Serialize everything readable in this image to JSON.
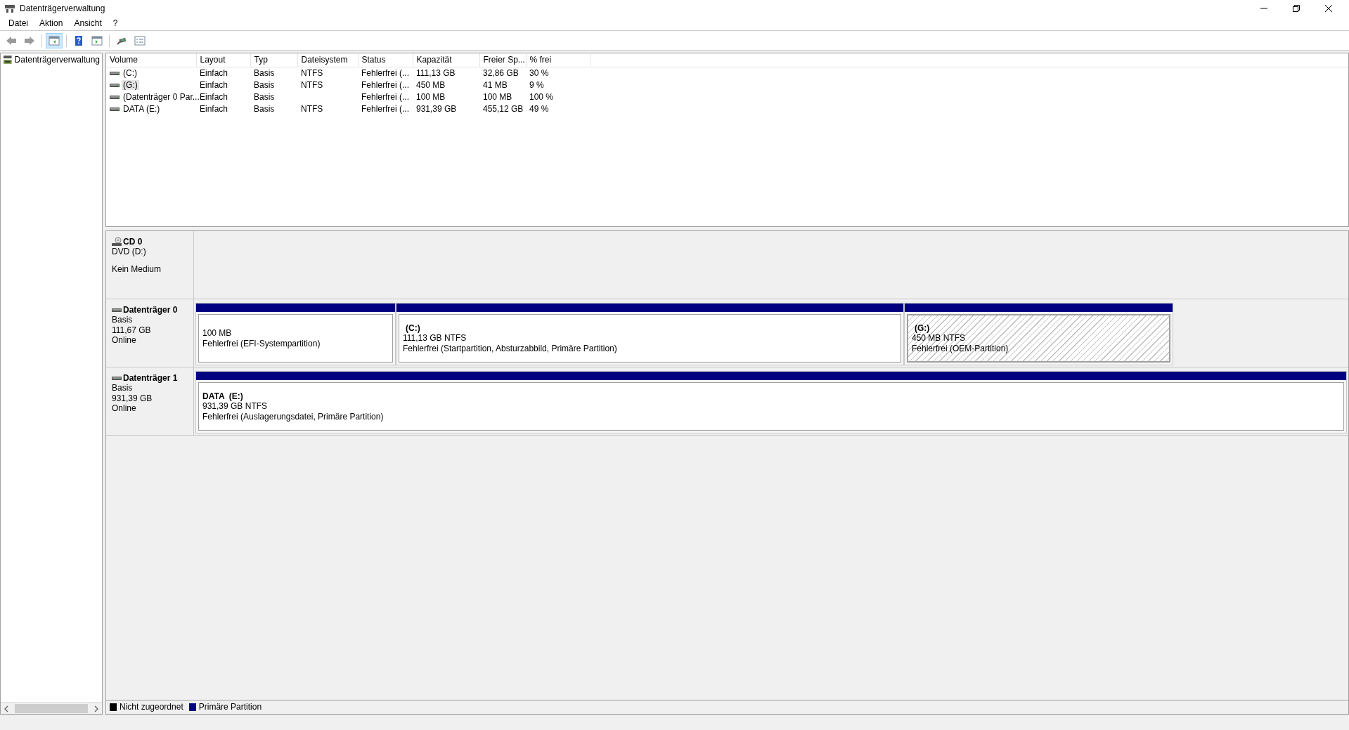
{
  "window": {
    "title": "Datenträgerverwaltung"
  },
  "menu": [
    "Datei",
    "Aktion",
    "Ansicht",
    "?"
  ],
  "toolbar": [
    {
      "kind": "back",
      "pressed": false
    },
    {
      "kind": "forward",
      "pressed": false
    },
    {
      "kind": "tree",
      "pressed": true
    },
    {
      "kind": "help",
      "pressed": false
    },
    {
      "kind": "pane",
      "pressed": false
    },
    {
      "kind": "connect",
      "pressed": false
    },
    {
      "kind": "list",
      "pressed": false
    }
  ],
  "tree": {
    "items": [
      {
        "label": "Datenträgerverwaltung",
        "selected": false
      }
    ]
  },
  "volume_table": {
    "columns": [
      "Volume",
      "Layout",
      "Typ",
      "Dateisystem",
      "Status",
      "Kapazität",
      "Freier Sp...",
      "% frei"
    ],
    "rows": [
      {
        "selected": false,
        "cells": [
          "(C:)",
          "Einfach",
          "Basis",
          "NTFS",
          "Fehlerfrei (...",
          "111,13 GB",
          "32,86 GB",
          "30 %"
        ]
      },
      {
        "selected": true,
        "cells": [
          "(G:)",
          "Einfach",
          "Basis",
          "NTFS",
          "Fehlerfrei (...",
          "450 MB",
          "41 MB",
          "9 %"
        ]
      },
      {
        "selected": false,
        "cells": [
          "(Datenträger 0 Par...",
          "Einfach",
          "Basis",
          "",
          "Fehlerfrei (...",
          "100 MB",
          "100 MB",
          "100 %"
        ]
      },
      {
        "selected": false,
        "cells": [
          "DATA (E:)",
          "Einfach",
          "Basis",
          "NTFS",
          "Fehlerfrei (...",
          "931,39 GB",
          "455,12 GB",
          "49 %"
        ]
      }
    ]
  },
  "disks": [
    {
      "kind": "cd",
      "name": "CD 0",
      "type": "DVD (D:)",
      "status": "Kein Medium"
    },
    {
      "kind": "disk",
      "name": "Datenträger 0",
      "type": "Basis",
      "size": "111,67 GB",
      "status": "Online",
      "partitions": [
        {
          "size": "100 MB",
          "status": "Fehlerfrei (EFI-Systempartition)",
          "selected": false
        },
        {
          "title": "(C:)",
          "size": "111,13 GB NTFS",
          "status": "Fehlerfrei (Startpartition, Absturzabbild, Primäre Partition)",
          "selected": false
        },
        {
          "title": "(G:)",
          "size": "450 MB NTFS",
          "status": "Fehlerfrei (OEM-Partition)",
          "selected": true
        }
      ]
    },
    {
      "kind": "disk",
      "name": "Datenträger 1",
      "type": "Basis",
      "size": "931,39 GB",
      "status": "Online",
      "partitions": [
        {
          "title": "DATA  (E:)",
          "size": "931,39 GB NTFS",
          "status": "Fehlerfrei (Auslagerungsdatei, Primäre Partition)",
          "selected": false
        }
      ]
    }
  ],
  "legend": [
    {
      "label": "Nicht zugeordnet",
      "color": "#000000"
    },
    {
      "label": "Primäre Partition",
      "color": "#000080"
    }
  ]
}
